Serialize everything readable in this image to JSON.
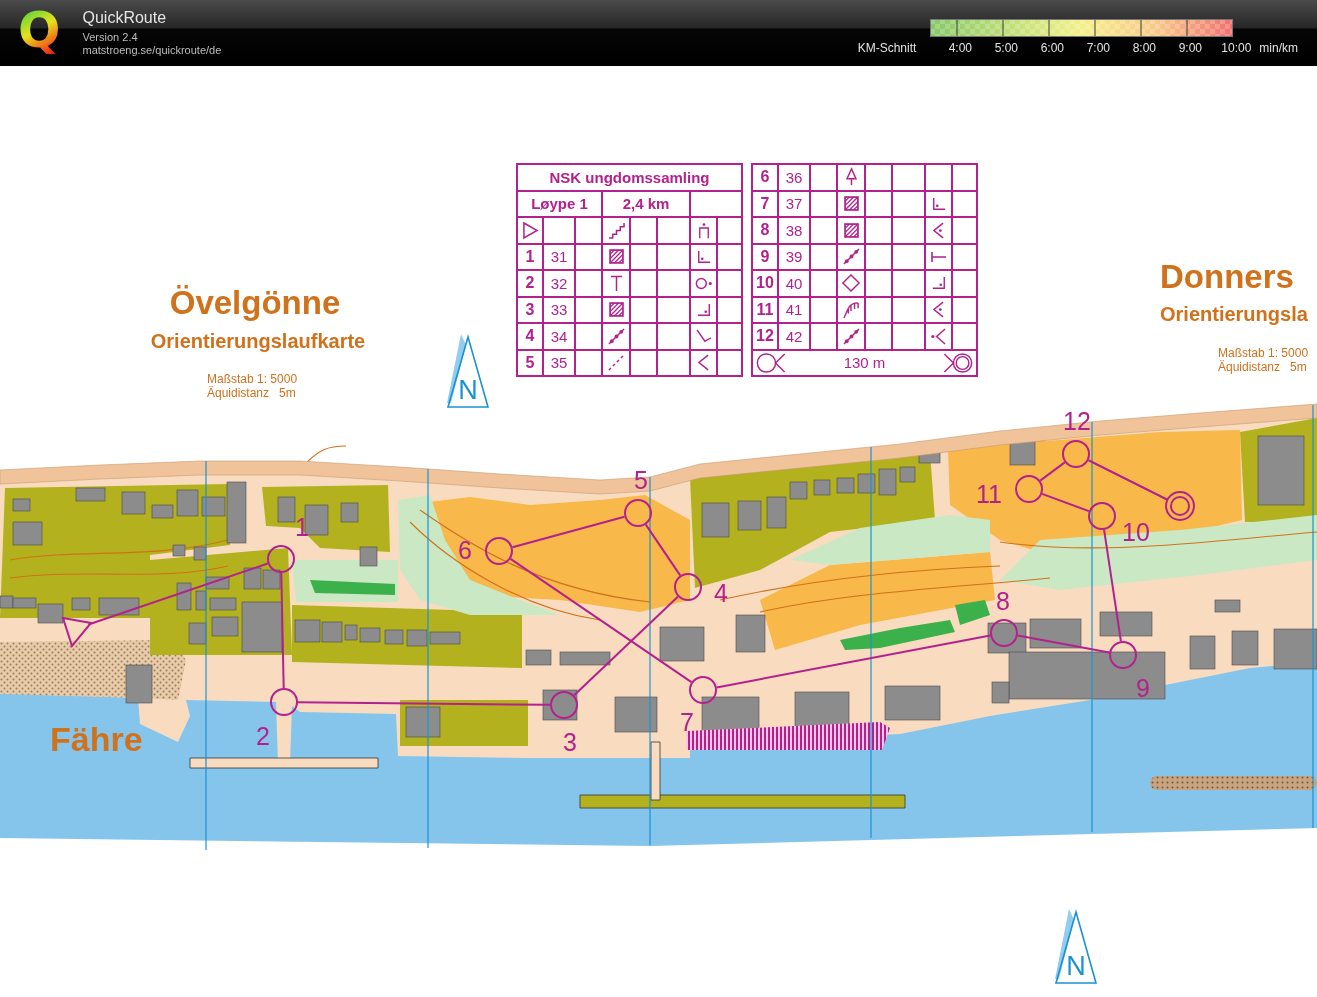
{
  "app": {
    "logo": "Q",
    "name": "QuickRoute",
    "version": "Version 2.4",
    "url": "matstroeng.se/quickroute/de"
  },
  "speed_legend": {
    "label": "KM-Schnitt",
    "ticks": [
      "4:00",
      "5:00",
      "6:00",
      "7:00",
      "8:00",
      "9:00",
      "10:00"
    ],
    "unit": "min/km"
  },
  "map": {
    "titles": [
      {
        "name": "Övelgönne",
        "subtitle": "Orientierungslaufkarte",
        "scale": "Maßstab 1: 5000",
        "contour_interval": "Äquidistanz   5m"
      },
      {
        "name": "Donners",
        "subtitle": "Orientierungsla",
        "scale": "Maßstab 1: 5000",
        "contour_interval": "Äquidistanz   5m"
      }
    ],
    "place_label": "Fähre",
    "north_arrows": [
      "N",
      "N"
    ],
    "control_labels": [
      "1",
      "2",
      "3",
      "4",
      "5",
      "6",
      "7",
      "8",
      "9",
      "10",
      "11",
      "12"
    ]
  },
  "control_description": {
    "event": "NSK ungdomssamling",
    "course": "Løype 1",
    "length": "2,4 km",
    "start": {
      "feature": {
        "kind": "stairs"
      },
      "position": {
        "kind": "doorway"
      }
    },
    "controls": [
      {
        "number": "1",
        "code": "31",
        "feature": {
          "kind": "hatched"
        },
        "position": {
          "kind": "cornersw"
        }
      },
      {
        "number": "2",
        "code": "32",
        "feature": {
          "kind": "tee"
        },
        "position": {
          "kind": "side"
        }
      },
      {
        "number": "3",
        "code": "33",
        "feature": {
          "kind": "hatched"
        },
        "position": {
          "kind": "cornerse"
        }
      },
      {
        "number": "4",
        "code": "34",
        "feature": {
          "kind": "wall"
        },
        "position": {
          "kind": "bend"
        }
      },
      {
        "number": "5",
        "code": "35",
        "feature": {
          "kind": "dashes"
        },
        "position": {
          "kind": "end"
        }
      },
      {
        "number": "6",
        "code": "36",
        "feature": {
          "kind": "tree"
        }
      },
      {
        "number": "7",
        "code": "37",
        "feature": {
          "kind": "hatched"
        },
        "position": {
          "kind": "cornersw"
        }
      },
      {
        "number": "8",
        "code": "38",
        "feature": {
          "kind": "hatched"
        },
        "position": {
          "kind": "enddot"
        }
      },
      {
        "number": "9",
        "code": "39",
        "feature": {
          "kind": "wall"
        },
        "position": {
          "kind": "foot"
        }
      },
      {
        "number": "10",
        "code": "40",
        "feature": {
          "kind": "diamond"
        },
        "position": {
          "kind": "cornerse"
        }
      },
      {
        "number": "11",
        "code": "41",
        "feature": {
          "kind": "railing"
        },
        "position": {
          "kind": "enddot"
        }
      },
      {
        "number": "12",
        "code": "42",
        "feature": {
          "kind": "wall"
        },
        "position": {
          "kind": "dotend"
        }
      }
    ],
    "finish": {
      "distance": "130 m"
    }
  }
}
